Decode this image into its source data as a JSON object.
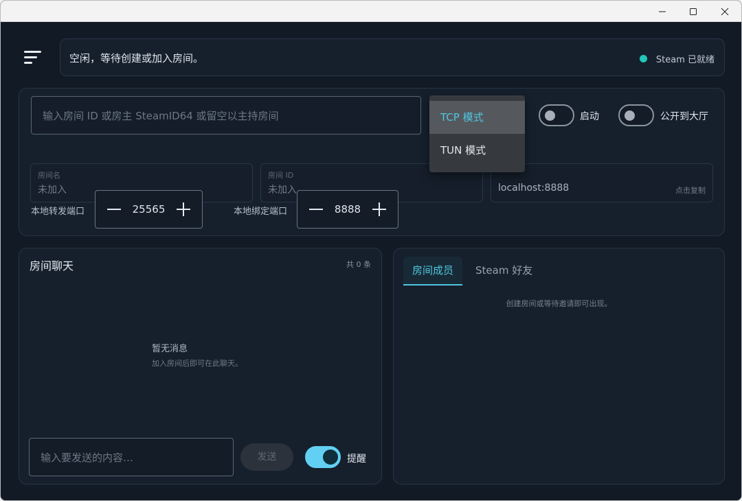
{
  "status": {
    "text": "空闲，等待创建或加入房间。",
    "steam_label": "Steam 已就绪",
    "steam_color": "#21c7b8"
  },
  "room": {
    "input_placeholder": "输入房间 ID 或房主 SteamID64 或留空以主持房间",
    "mode_options": [
      "TCP 模式",
      "TUN 模式"
    ],
    "selected_mode": "TCP 模式",
    "start_label": "启动",
    "start_on": false,
    "public_label": "公开到大厅",
    "public_on": false,
    "name_label": "房间名",
    "name_value": "未加入",
    "id_label": "房间 ID",
    "id_value": "未加入",
    "address_value": "localhost:8888",
    "copy_label": "点击复制",
    "forward_port_label": "本地转发端口",
    "forward_port_value": "25565",
    "bind_port_label": "本地绑定端口",
    "bind_port_value": "8888"
  },
  "chat": {
    "title": "房间聊天",
    "count": "共 0 条",
    "empty_title": "暂无消息",
    "empty_sub": "加入房间后即可在此聊天。",
    "input_placeholder": "输入要发送的内容…",
    "send_label": "发送",
    "remind_label": "提醒",
    "remind_on": true
  },
  "members": {
    "tabs": [
      "房间成员",
      "Steam 好友"
    ],
    "active_tab": "房间成员",
    "empty_text": "创建房间或等待邀请即可出现。"
  },
  "colors": {
    "accent": "#4fc7e0",
    "background": "#121a26",
    "panel": "#16202d"
  }
}
